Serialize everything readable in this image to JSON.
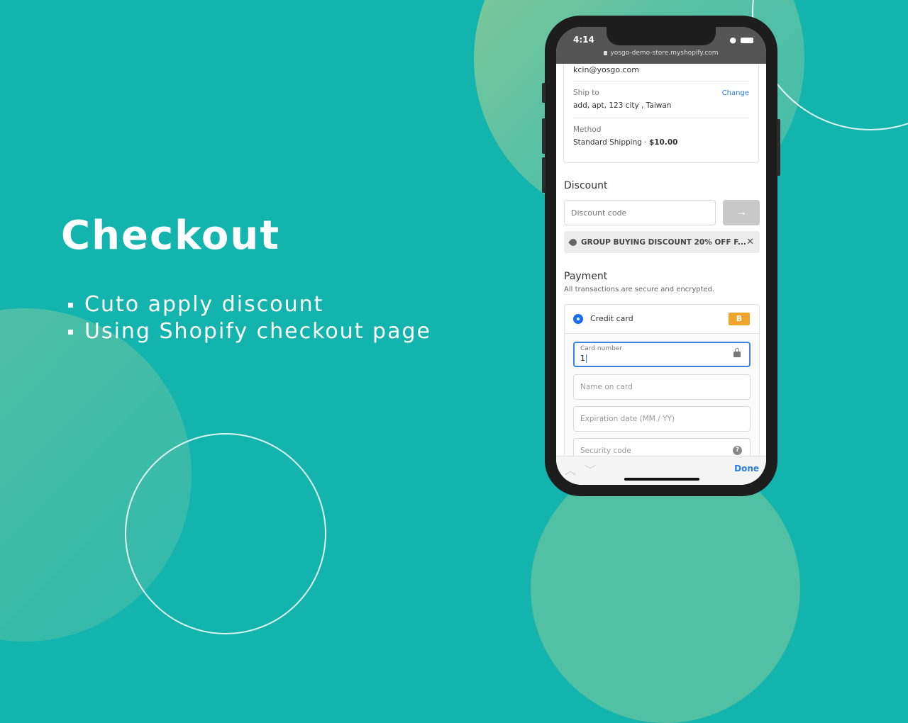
{
  "hero": {
    "title": "Checkout",
    "bullets": [
      "Cuto apply discount",
      "Using Shopify checkout page"
    ]
  },
  "colors": {
    "background": "#14b4ae",
    "link": "#2d7be5",
    "radio": "#1b6ef3",
    "card_badge": "#f0a42a"
  },
  "phone": {
    "status": {
      "time": "4:14",
      "wifi_icon": "wifi-icon",
      "battery_icon": "battery-icon"
    },
    "url": "yosgo-demo-store.myshopify.com",
    "contact": {
      "email": "kcin@yosgo.com"
    },
    "ship_to": {
      "label": "Ship to",
      "value": "add, apt, 123 city , Taiwan",
      "change_label": "Change"
    },
    "method": {
      "label": "Method",
      "value_prefix": "Standard Shipping · ",
      "price": "$10.00"
    },
    "discount": {
      "title": "Discount",
      "placeholder": "Discount code",
      "apply_icon": "arrow-right-icon",
      "applied_code": "GROUP BUYING DISCOUNT 20% OFF F...",
      "remove_icon": "close-icon"
    },
    "payment": {
      "title": "Payment",
      "subtitle": "All transactions are secure and encrypted.",
      "method_label": "Credit card",
      "badge": "B",
      "card_number": {
        "label": "Card number",
        "value": "1"
      },
      "name_placeholder": "Name on card",
      "expiry_placeholder": "Expiration date (MM / YY)",
      "security_placeholder": "Security code",
      "help_glyph": "?"
    },
    "keyboard": {
      "up": "︿",
      "down": "﹀",
      "done_label": "Done"
    }
  }
}
